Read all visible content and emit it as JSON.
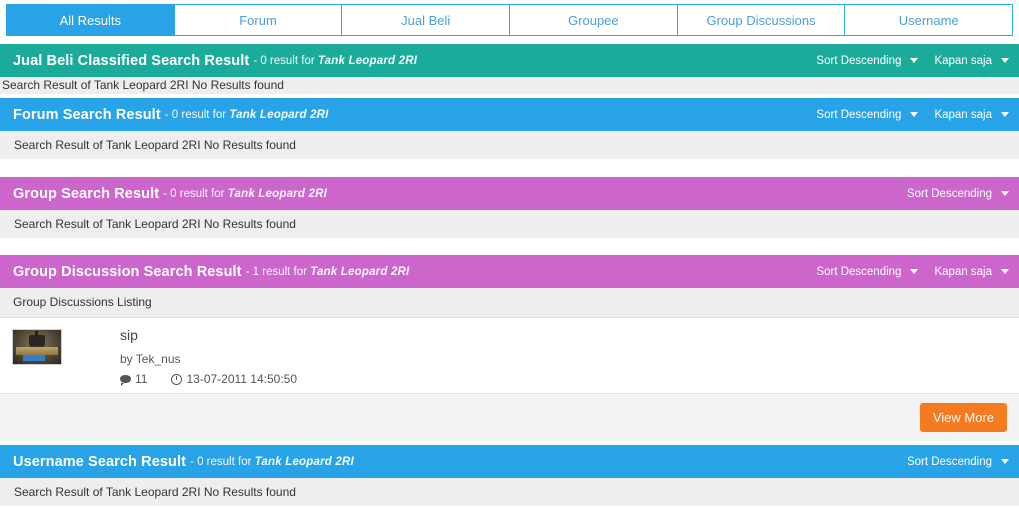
{
  "tabs": [
    {
      "label": "All Results",
      "active": true
    },
    {
      "label": "Forum",
      "active": false
    },
    {
      "label": "Jual Beli",
      "active": false
    },
    {
      "label": "Groupee",
      "active": false
    },
    {
      "label": "Group Discussions",
      "active": false
    },
    {
      "label": "Username",
      "active": false
    }
  ],
  "search_term": "Tank Leopard 2RI",
  "colors": {
    "teal": "#1aab9b",
    "blue": "#29a3e8",
    "purple": "#cc66cc",
    "orange": "#f47b20",
    "body_bg": "#eeeeee"
  },
  "sections": {
    "jualbeli": {
      "title": "Jual Beli Classified Search Result",
      "subtitle": "- 0 result for",
      "term": "Tank Leopard 2RI",
      "sort_label": "Sort Descending",
      "time_label": "Kapan saja",
      "body": "Search Result of Tank Leopard 2RI No Results found"
    },
    "forum": {
      "title": "Forum Search Result",
      "subtitle": "- 0 result for",
      "term": "Tank Leopard 2RI",
      "sort_label": "Sort Descending",
      "time_label": "Kapan saja",
      "body": "Search Result of Tank Leopard 2RI No Results found"
    },
    "group": {
      "title": "Group Search Result",
      "subtitle": "- 0 result for",
      "term": "Tank Leopard 2RI",
      "sort_label": "Sort Descending",
      "body": "Search Result of Tank Leopard 2RI No Results found"
    },
    "groupdiscussion": {
      "title": "Group Discussion Search Result",
      "subtitle": "- 1 result for",
      "term": "Tank Leopard 2RI",
      "sort_label": "Sort Descending",
      "time_label": "Kapan saja",
      "listing_header": "Group Discussions Listing",
      "view_more_label": "View More",
      "results": [
        {
          "title": "sip",
          "author": "by Tek_nus",
          "comment_count": "11",
          "timestamp": "13-07-2011 14:50:50",
          "thumbnail_alt": "world-of-tanks-thumbnail"
        }
      ]
    },
    "username": {
      "title": "Username Search Result",
      "subtitle": "- 0 result for",
      "term": "Tank Leopard 2RI",
      "sort_label": "Sort Descending",
      "body": "Search Result of Tank Leopard 2RI No Results found"
    }
  }
}
